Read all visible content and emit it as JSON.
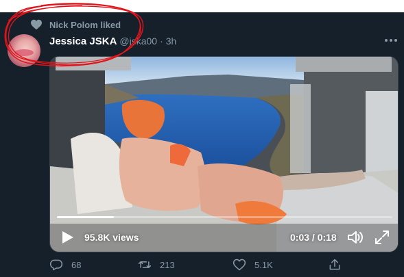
{
  "social_context": {
    "text": "Nick Polom liked",
    "icon": "heart-icon"
  },
  "tweet": {
    "author_name": "Jessica JSKA",
    "author_handle": "@jska00",
    "separator": "·",
    "timestamp": "3h"
  },
  "video": {
    "views": "95.8K views",
    "time": "0:03 / 0:18",
    "progress": 0.17
  },
  "actions": {
    "replies": "68",
    "retweets": "213",
    "likes": "5.1K"
  },
  "colors": {
    "background": "#15202b",
    "muted_text": "#8899a6",
    "annotation_red": "#e0151b"
  }
}
